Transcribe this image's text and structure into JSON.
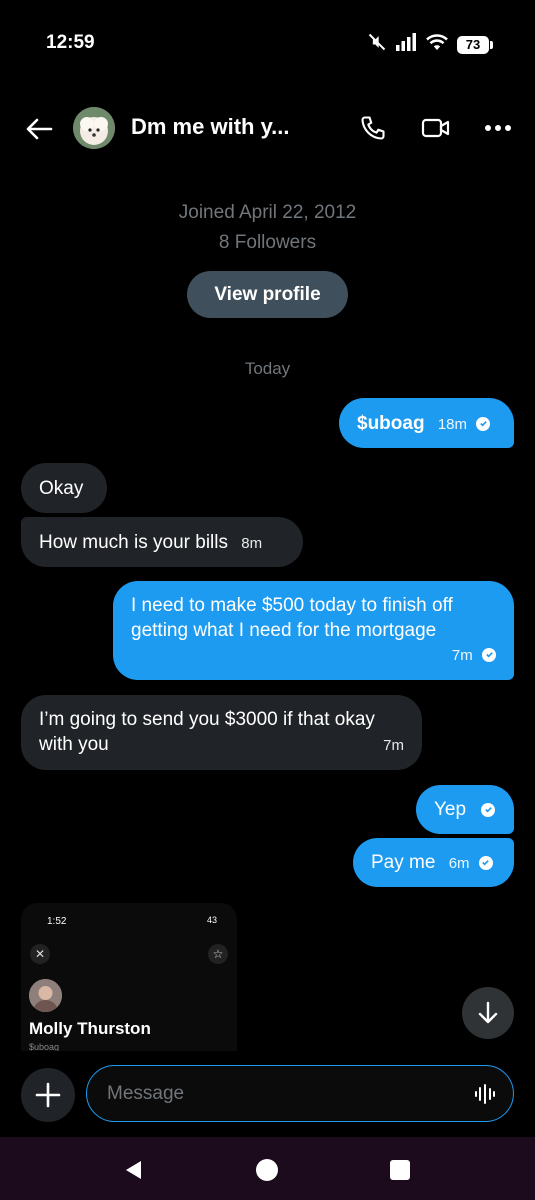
{
  "status_bar": {
    "time": "12:59",
    "battery": "73"
  },
  "header": {
    "title": "Dm me with y..."
  },
  "profile": {
    "joined": "Joined April 22, 2012",
    "followers": "8 Followers",
    "view_profile_label": "View profile"
  },
  "day_label": "Today",
  "messages": [
    {
      "direction": "out",
      "text": "$uboag",
      "time": "18m"
    },
    {
      "direction": "in",
      "text": "Okay",
      "time": ""
    },
    {
      "direction": "in",
      "text": "How much is your bills",
      "time": "8m"
    },
    {
      "direction": "out",
      "text": "I need to make $500 today to finish off getting what I need for the mortgage",
      "time": "7m"
    },
    {
      "direction": "in",
      "text": "I’m going to send you $3000 if that okay with you",
      "time": "7m"
    },
    {
      "direction": "out",
      "text": "Yep",
      "time": ""
    },
    {
      "direction": "out",
      "text": "Pay me",
      "time": "6m"
    }
  ],
  "attachment": {
    "time": "1:52",
    "battery": "43",
    "name": "Molly Thurston",
    "handle": "$uboag"
  },
  "compose": {
    "placeholder": "Message"
  },
  "colors": {
    "accent": "#1d9bf0",
    "incoming_bubble": "#202327",
    "background": "#000000"
  }
}
